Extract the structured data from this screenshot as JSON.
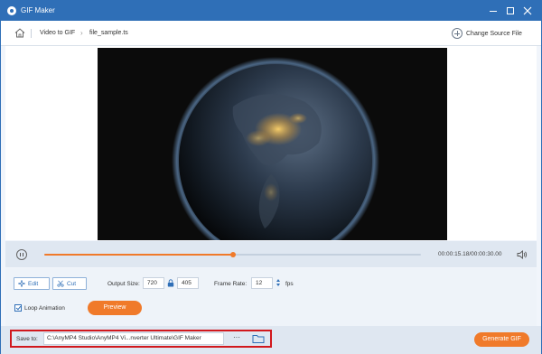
{
  "window": {
    "title": "GIF Maker",
    "accent_color": "#2f6fb7",
    "highlight_color": "#d1181d",
    "orange_color": "#f07a2a"
  },
  "breadcrumb": {
    "items": [
      "Video to GIF",
      "file_sample.ts"
    ],
    "change_source_label": "Change Source File"
  },
  "player": {
    "progress_fraction": 0.5,
    "current_time": "00:00:15.18",
    "total_time": "00:00:30.00",
    "time_display": "00:00:15.18/00:00:30.00"
  },
  "settings": {
    "edit_label": "Edit",
    "cut_label": "Cut",
    "output_size_label": "Output Size:",
    "width": "720",
    "height": "405",
    "frame_rate_label": "Frame Rate:",
    "frame_rate": "12",
    "fps_label": "fps",
    "loop_label": "Loop Animation",
    "loop_checked": true,
    "preview_label": "Preview"
  },
  "bottom": {
    "save_to_label": "Save to:",
    "save_path": "C:\\AnyMP4 Studio\\AnyMP4 Vi...nverter Ultimate\\GIF Maker",
    "more_label": "···",
    "generate_label": "Generate GIF"
  }
}
